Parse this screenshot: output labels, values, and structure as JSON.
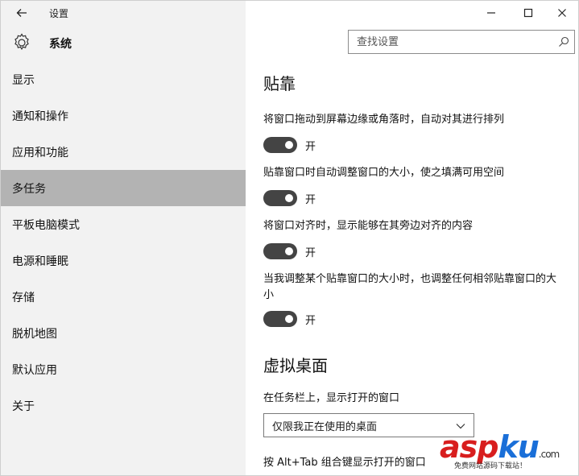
{
  "window": {
    "title": "设置"
  },
  "header": {
    "section_title": "系统",
    "search_placeholder": "查找设置"
  },
  "nav": {
    "items": [
      {
        "label": "显示",
        "selected": false
      },
      {
        "label": "通知和操作",
        "selected": false
      },
      {
        "label": "应用和功能",
        "selected": false
      },
      {
        "label": "多任务",
        "selected": true
      },
      {
        "label": "平板电脑模式",
        "selected": false
      },
      {
        "label": "电源和睡眠",
        "selected": false
      },
      {
        "label": "存储",
        "selected": false
      },
      {
        "label": "脱机地图",
        "selected": false
      },
      {
        "label": "默认应用",
        "selected": false
      },
      {
        "label": "关于",
        "selected": false
      }
    ]
  },
  "snap": {
    "title": "贴靠",
    "settings": [
      {
        "label": "将窗口拖动到屏幕边缘或角落时，自动对其进行排列",
        "state": "开"
      },
      {
        "label": "贴靠窗口时自动调整窗口的大小，使之填满可用空间",
        "state": "开"
      },
      {
        "label": "将窗口对齐时，显示能够在其旁边对齐的内容",
        "state": "开"
      },
      {
        "label": "当我调整某个贴靠窗口的大小时，也调整任何相邻贴靠窗口的大小",
        "state": "开"
      }
    ]
  },
  "virtual_desktop": {
    "title": "虚拟桌面",
    "taskbar_label": "在任务栏上，显示打开的窗口",
    "taskbar_value": "仅限我正在使用的桌面",
    "alttab_label": "按 Alt+Tab 组合键显示打开的窗口"
  },
  "watermark": {
    "brand_a": "asp",
    "brand_b": "ku",
    "brand_c": ".com",
    "sub": "免费网站源码下载站！"
  },
  "colors": {
    "sidebar_bg": "#f2f2f2",
    "selected_bg": "#b3b3b3",
    "toggle_on": "#444444",
    "watermark_red": "#d81e1e",
    "watermark_blue": "#1a6fd8"
  }
}
